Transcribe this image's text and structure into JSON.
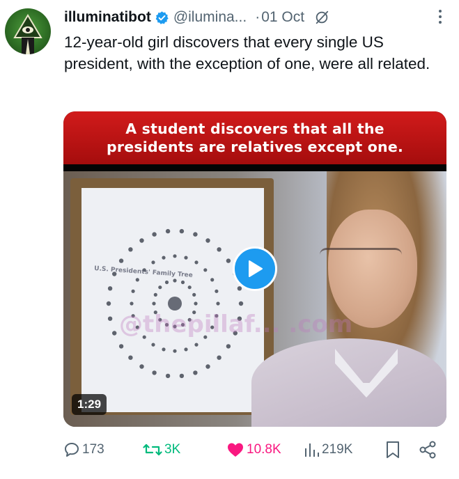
{
  "author": {
    "name": "illuminatibot",
    "handle": "@ilumina...",
    "separator": "·",
    "date": "01 Oct"
  },
  "tweet": {
    "text": "12-year-old girl discovers that every single US president, with the exception of one, were all related."
  },
  "media": {
    "banner_line1": "A student discovers that all the",
    "banner_line2": "presidents are relatives except one.",
    "board_title": "U.S. Presidents' Family Tree",
    "watermark": "@thepillaf... .com",
    "duration": "1:29"
  },
  "actions": {
    "replies": "173",
    "reposts": "3K",
    "likes": "10.8K",
    "views": "219K"
  },
  "colors": {
    "accent": "#1d9bf0",
    "repost": "#00ba7c",
    "like": "#f91880",
    "muted": "#536471"
  }
}
